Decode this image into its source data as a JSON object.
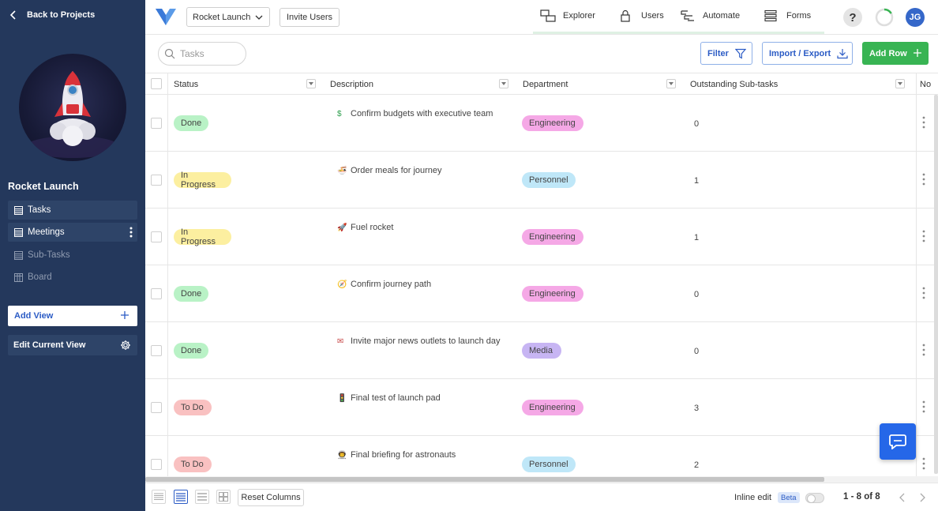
{
  "sidebar": {
    "back_label": "Back to Projects",
    "project_title": "Rocket Launch",
    "views": [
      {
        "label": "Tasks",
        "state": "selected"
      },
      {
        "label": "Meetings",
        "state": "hover"
      },
      {
        "label": "Sub-Tasks",
        "state": "dim"
      },
      {
        "label": "Board",
        "state": "dim"
      }
    ],
    "add_view_label": "Add View",
    "edit_view_label": "Edit Current View"
  },
  "topbar": {
    "project_select": "Rocket Launch",
    "invite_label": "Invite Users",
    "nav": [
      {
        "label": "Explorer",
        "icon": "explorer-icon"
      },
      {
        "label": "Users",
        "icon": "lock-icon"
      },
      {
        "label": "Automate",
        "icon": "automate-icon"
      },
      {
        "label": "Forms",
        "icon": "forms-icon"
      }
    ],
    "help_label": "?",
    "user_initials": "JG"
  },
  "toolbar": {
    "search_placeholder": "Tasks",
    "filter_label": "Filter",
    "import_export_label": "Import / Export",
    "add_row_label": "Add Row"
  },
  "table": {
    "columns": [
      "Status",
      "Description",
      "Department",
      "Outstanding Sub-tasks",
      "No"
    ],
    "rows": [
      {
        "status": "Done",
        "emoji": "$",
        "description": "Confirm budgets with executive team",
        "department": "Engineering",
        "subtasks": "0"
      },
      {
        "status": "In Progress",
        "emoji": "🍜",
        "description": "Order meals for journey",
        "department": "Personnel",
        "subtasks": "1"
      },
      {
        "status": "In Progress",
        "emoji": "🚀",
        "description": "Fuel rocket",
        "department": "Engineering",
        "subtasks": "1"
      },
      {
        "status": "Done",
        "emoji": "🧭",
        "description": "Confirm journey path",
        "department": "Engineering",
        "subtasks": "0"
      },
      {
        "status": "Done",
        "emoji": "✉",
        "description": "Invite major news outlets to launch day",
        "department": "Media",
        "subtasks": "0"
      },
      {
        "status": "To Do",
        "emoji": "🚦",
        "description": "Final test of launch pad",
        "department": "Engineering",
        "subtasks": "3"
      },
      {
        "status": "To Do",
        "emoji": "👨‍🚀",
        "description": "Final briefing for astronauts",
        "department": "Personnel",
        "subtasks": "2"
      }
    ]
  },
  "status_colors": {
    "Done": "#b9f2c6",
    "In Progress": "#fcefa0",
    "To Do": "#f9c1c1"
  },
  "department_colors": {
    "Engineering": "#f5a8e6",
    "Personnel": "#bfe7f8",
    "Media": "#c7b5f3"
  },
  "footer": {
    "reset_columns_label": "Reset Columns",
    "inline_edit_label": "Inline edit",
    "beta_label": "Beta",
    "pagination": "1 - 8 of 8"
  }
}
